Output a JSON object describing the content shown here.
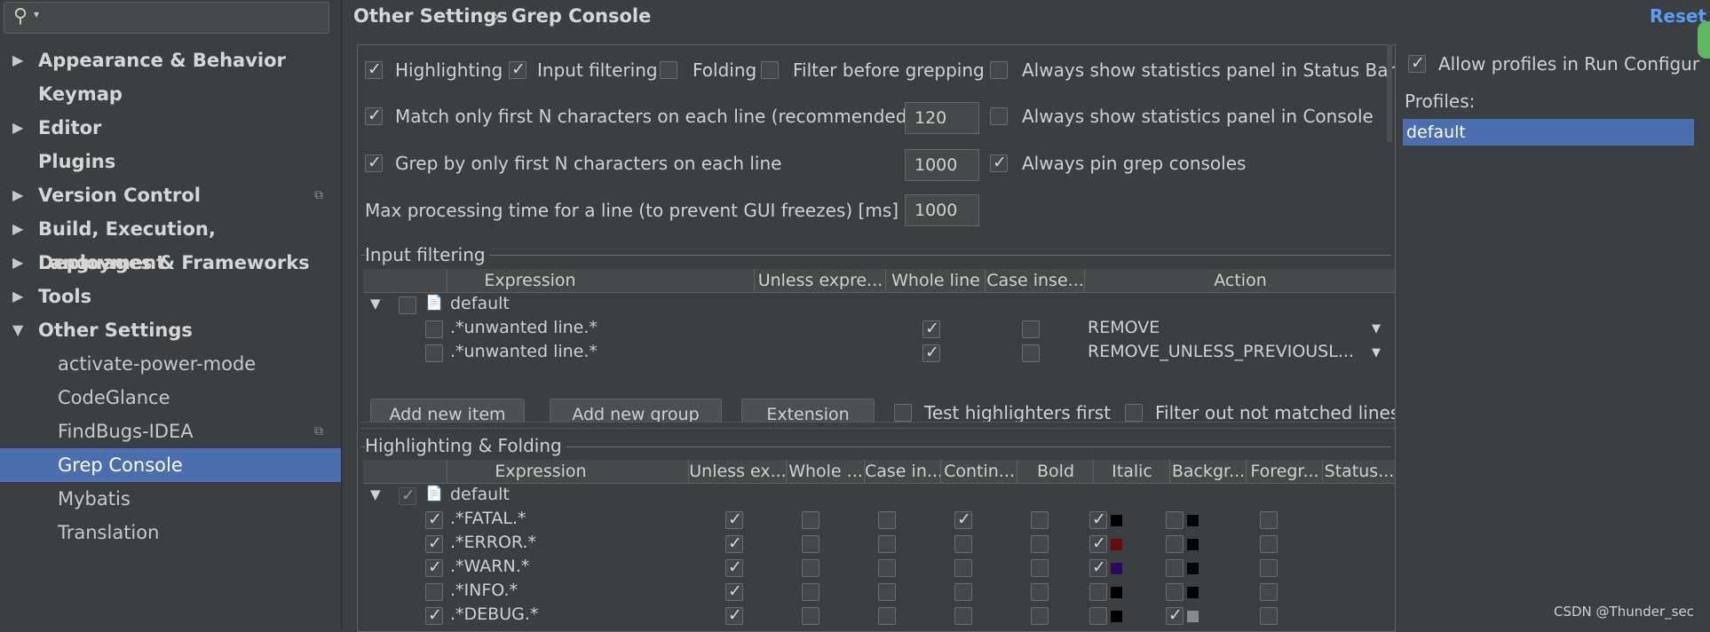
{
  "sidebar": {
    "search_icon": "search-icon",
    "items": [
      {
        "label": "Appearance & Behavior",
        "arrow": "▶",
        "level": 0
      },
      {
        "label": "Keymap",
        "arrow": "",
        "level": 0
      },
      {
        "label": "Editor",
        "arrow": "▶",
        "level": 0
      },
      {
        "label": "Plugins",
        "arrow": "",
        "level": 0
      },
      {
        "label": "Version Control",
        "arrow": "▶",
        "level": 0
      },
      {
        "label": "Build, Execution, Deployment",
        "arrow": "▶",
        "level": 0
      },
      {
        "label": "Languages & Frameworks",
        "arrow": "▶",
        "level": 0
      },
      {
        "label": "Tools",
        "arrow": "▶",
        "level": 0
      },
      {
        "label": "Other Settings",
        "arrow": "▼",
        "level": 0
      },
      {
        "label": "activate-power-mode",
        "arrow": "",
        "level": 1
      },
      {
        "label": "CodeGlance",
        "arrow": "",
        "level": 1
      },
      {
        "label": "FindBugs-IDEA",
        "arrow": "",
        "level": 1
      },
      {
        "label": "Grep Console",
        "arrow": "",
        "level": 1
      },
      {
        "label": "Mybatis",
        "arrow": "",
        "level": 1
      },
      {
        "label": "Translation",
        "arrow": "",
        "level": 1
      }
    ]
  },
  "header": {
    "crumb1": "Other Settings",
    "separator": "›",
    "crumb2": "Grep Console",
    "reset": "Reset"
  },
  "options": {
    "highlighting": "Highlighting",
    "input_filtering": "Input filtering",
    "folding": "Folding",
    "filter_before": "Filter before grepping",
    "stats_status_bar": "Always show statistics panel in Status Bar",
    "match_first_n": "Match only first N characters on each line (recommended)",
    "match_first_n_value": "120",
    "stats_console": "Always show statistics panel in Console",
    "grep_first_n": "Grep by only first N characters on each line",
    "grep_first_n_value": "1000",
    "pin_consoles": "Always pin grep consoles",
    "max_time": "Max processing time for a line (to prevent GUI freezes) [ms]",
    "max_time_value": "1000"
  },
  "input_filtering": {
    "title": "Input filtering",
    "headers": [
      "Expression",
      "Unless expre...",
      "Whole line",
      "Case inse...",
      "Action"
    ],
    "group": "default",
    "rows": [
      {
        "expr": ".*unwanted line.*",
        "action": "REMOVE"
      },
      {
        "expr": ".*unwanted line.*",
        "action": "REMOVE_UNLESS_PREVIOUSL..."
      }
    ],
    "buttons": [
      "Add new item",
      "Add new group",
      "Extension"
    ],
    "test_first": "Test highlighters first",
    "filter_out": "Filter out not matched lines"
  },
  "highlighting": {
    "title": "Highlighting & Folding",
    "headers": [
      "Expression",
      "Unless ex...",
      "Whole ...",
      "Case in...",
      "Contin...",
      "Bold",
      "Italic",
      "Backgr...",
      "Foregr...",
      "Status..."
    ],
    "group": "default",
    "rows": [
      {
        "expr": ".*FATAL.*",
        "enabled": true,
        "bold": true,
        "bg_on": true,
        "bg": "#000000",
        "fg_on": false,
        "fg": "#000000"
      },
      {
        "expr": ".*ERROR.*",
        "enabled": true,
        "bold": false,
        "bg_on": true,
        "bg": "#6b0a0a",
        "fg_on": false,
        "fg": "#000000"
      },
      {
        "expr": ".*WARN.*",
        "enabled": true,
        "bold": false,
        "bg_on": true,
        "bg": "#2a0a5e",
        "fg_on": false,
        "fg": "#000000"
      },
      {
        "expr": ".*INFO.*",
        "enabled": false,
        "bold": false,
        "bg_on": false,
        "bg": "#000000",
        "fg_on": false,
        "fg": "#000000"
      },
      {
        "expr": ".*DEBUG.*",
        "enabled": true,
        "bold": false,
        "bg_on": false,
        "bg": "#000000",
        "fg_on": true,
        "fg": "#8a8a8a"
      }
    ]
  },
  "right_panel": {
    "allow_profiles": "Allow profiles in Run Configur",
    "profiles_label": "Profiles:",
    "profiles": [
      "default"
    ]
  },
  "watermark": "CSDN @Thunder_sec",
  "colors": {
    "accent": "#4b6eaf",
    "link": "#589df6",
    "background": "#3c3f41"
  }
}
